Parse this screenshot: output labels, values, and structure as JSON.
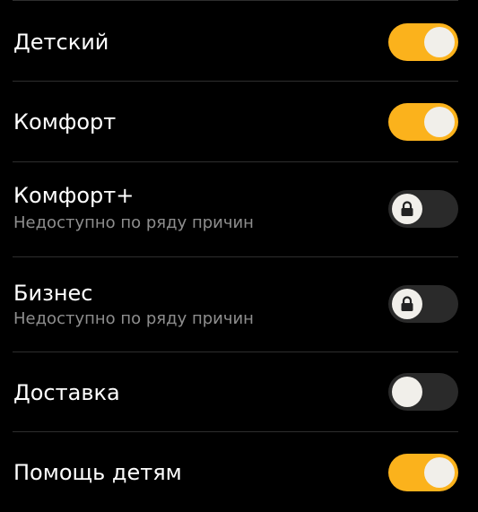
{
  "options": [
    {
      "title": "Детский",
      "subtitle": "",
      "state": "on",
      "locked": false,
      "icon": "toggle-switch"
    },
    {
      "title": "Комфорт",
      "subtitle": "",
      "state": "on",
      "locked": false,
      "icon": "toggle-switch"
    },
    {
      "title": "Комфорт+",
      "subtitle": "Недоступно по ряду причин",
      "state": "off",
      "locked": true,
      "icon": "lock-icon"
    },
    {
      "title": "Бизнес",
      "subtitle": "Недоступно по ряду причин",
      "state": "off",
      "locked": true,
      "icon": "lock-icon"
    },
    {
      "title": "Доставка",
      "subtitle": "",
      "state": "off",
      "locked": false,
      "icon": "toggle-switch"
    },
    {
      "title": "Помощь детям",
      "subtitle": "",
      "state": "on",
      "locked": false,
      "icon": "toggle-switch"
    }
  ],
  "colors": {
    "background": "#000000",
    "toggle_on": "#fbb21c",
    "toggle_off": "#2a2a2a",
    "knob": "#f1efea",
    "subtitle": "#8e8e8e",
    "divider": "#2e2e2e"
  }
}
